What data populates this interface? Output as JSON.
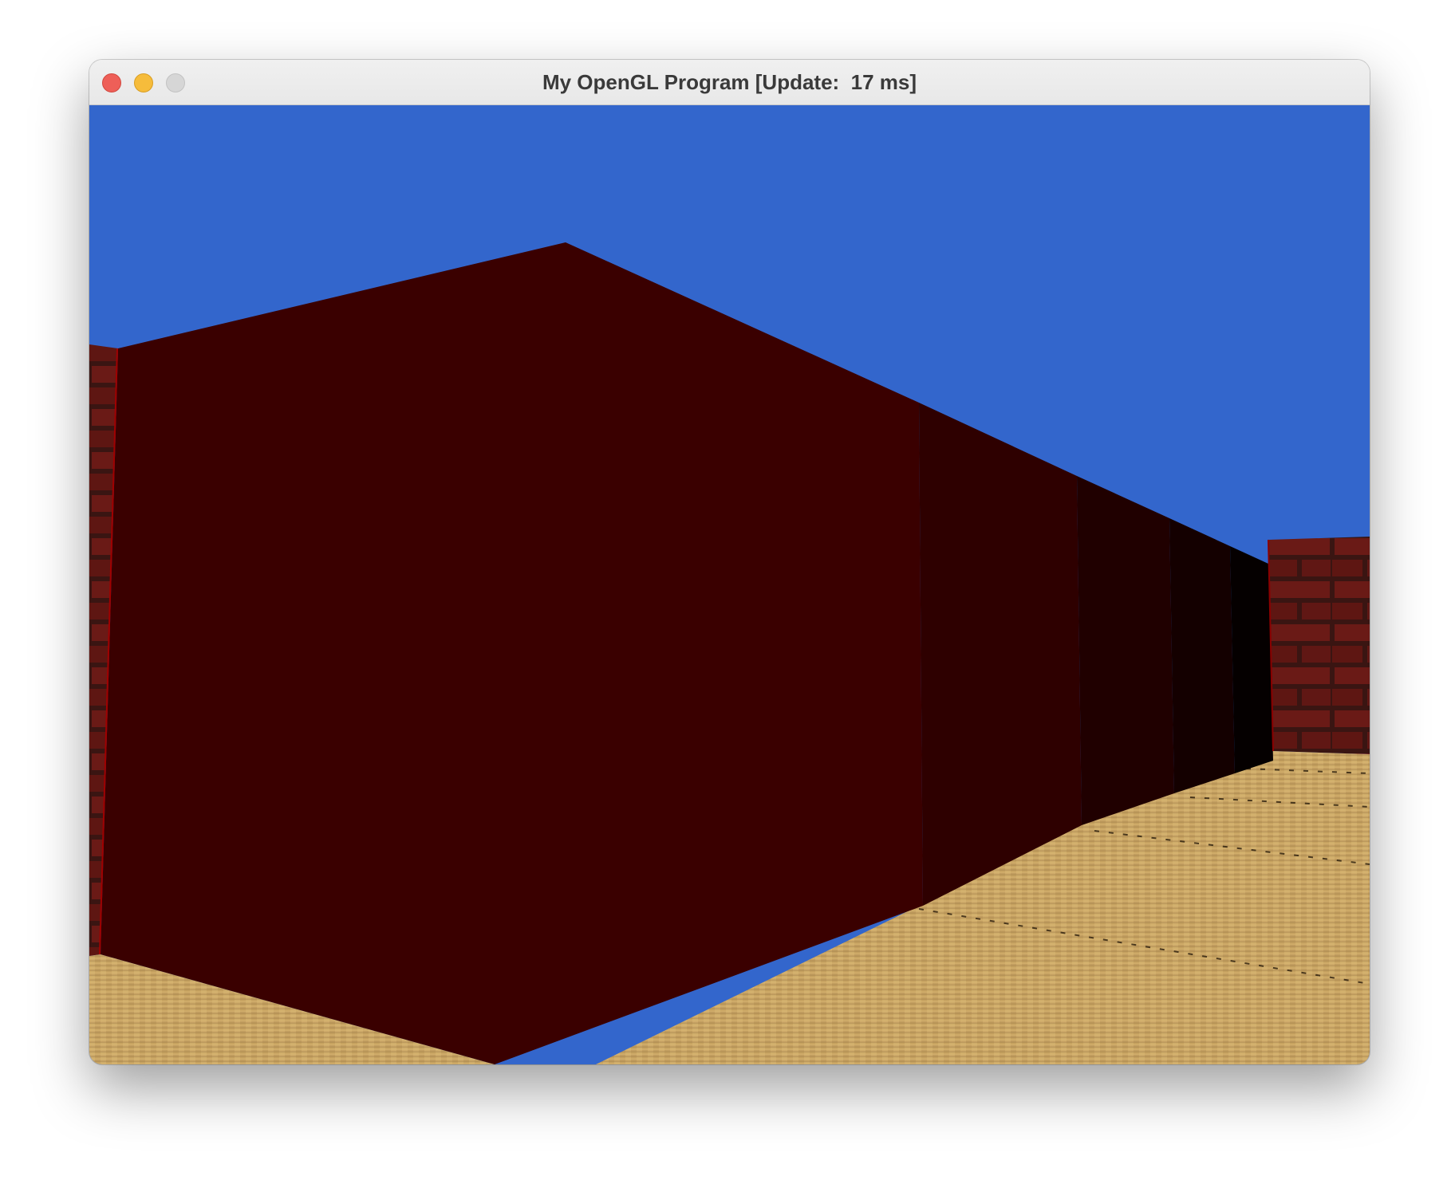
{
  "window": {
    "title": "My OpenGL Program [Update:  17 ms]"
  },
  "scene": {
    "sky_color": "#3366cc",
    "wall_color": "#3a0000",
    "brick_color": "#5a1410",
    "floor_color": "#c8a060"
  },
  "icons": {
    "close": "close-icon",
    "minimize": "minimize-icon",
    "zoom": "zoom-icon"
  }
}
